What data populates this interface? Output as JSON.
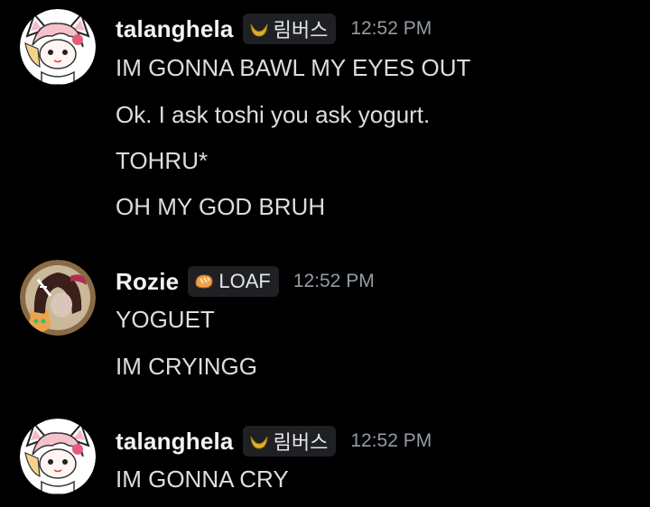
{
  "groups": [
    {
      "username": "talanghela",
      "tag": {
        "icon": "gold-crescent-icon",
        "label": "림버스"
      },
      "timestamp": "12:52 PM",
      "avatar": "white-cat-girl-avatar",
      "messages": [
        "IM GONNA BAWL MY EYES OUT",
        "Ok. I ask toshi you ask yogurt.",
        "TOHRU*",
        "OH MY GOD BRUH"
      ]
    },
    {
      "username": "Rozie",
      "tag": {
        "icon": "bread-loaf-icon",
        "label": "LOAF"
      },
      "timestamp": "12:52 PM",
      "avatar": "dark-hair-girl-with-cat-avatar",
      "messages": [
        "YOGUET",
        "IM CRYINGG"
      ]
    },
    {
      "username": "talanghela",
      "tag": {
        "icon": "gold-crescent-icon",
        "label": "림버스"
      },
      "timestamp": "12:52 PM",
      "avatar": "white-cat-girl-avatar",
      "messages": [
        "IM GONNA CRY"
      ]
    }
  ],
  "colors": {
    "background": "#000000",
    "username": "#f2f3f5",
    "message_text": "#dbdee1",
    "timestamp": "#949ba4",
    "tag_background": "#1f2023",
    "crescent_gold": "#e0b12a",
    "loaf_orange": "#f0a24a"
  }
}
